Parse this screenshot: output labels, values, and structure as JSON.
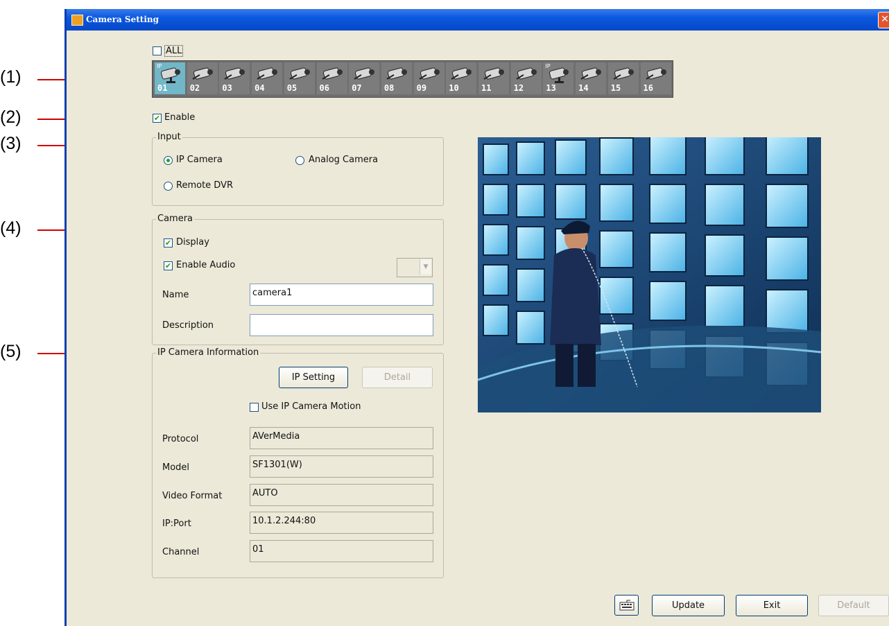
{
  "callouts": [
    "(1)",
    "(2)",
    "(3)",
    "(4)",
    "(5)"
  ],
  "window": {
    "title": "Camera Setting",
    "close_glyph": "✕"
  },
  "all_checkbox": {
    "label": "ALL",
    "checked": false
  },
  "camera_strip": {
    "selected": "01",
    "cameras": [
      {
        "num": "01",
        "ip": true
      },
      {
        "num": "02",
        "ip": false
      },
      {
        "num": "03",
        "ip": false
      },
      {
        "num": "04",
        "ip": false
      },
      {
        "num": "05",
        "ip": false
      },
      {
        "num": "06",
        "ip": false
      },
      {
        "num": "07",
        "ip": false
      },
      {
        "num": "08",
        "ip": false
      },
      {
        "num": "09",
        "ip": false
      },
      {
        "num": "10",
        "ip": false
      },
      {
        "num": "11",
        "ip": false
      },
      {
        "num": "12",
        "ip": false
      },
      {
        "num": "13",
        "ip": true
      },
      {
        "num": "14",
        "ip": false
      },
      {
        "num": "15",
        "ip": false
      },
      {
        "num": "16",
        "ip": false
      }
    ],
    "ip_tag": "IP"
  },
  "enable": {
    "label": "Enable",
    "checked": true
  },
  "input_group": {
    "title": "Input",
    "options": [
      {
        "label": "IP Camera",
        "selected": true
      },
      {
        "label": "Analog Camera",
        "selected": false
      },
      {
        "label": "Remote DVR",
        "selected": false
      }
    ]
  },
  "camera_group": {
    "title": "Camera",
    "display_label": "Display",
    "display_checked": true,
    "audio_label": "Enable Audio",
    "audio_checked": true,
    "audio_select_value": "",
    "name_label": "Name",
    "name_value": "camera1",
    "description_label": "Description",
    "description_value": ""
  },
  "ip_group": {
    "title": "IP Camera Information",
    "ip_setting_label": "IP Setting",
    "detail_label": "Detail",
    "motion_label": "Use IP Camera Motion",
    "motion_checked": false,
    "fields": [
      {
        "label": "Protocol",
        "value": "AVerMedia"
      },
      {
        "label": "Model",
        "value": "SF1301(W)"
      },
      {
        "label": "Video Format",
        "value": "AUTO"
      },
      {
        "label": "IP:Port",
        "value": "10.1.2.244:80"
      },
      {
        "label": "Channel",
        "value": "01"
      }
    ]
  },
  "bottom_buttons": {
    "keyboard_icon": "keyboard-icon",
    "update": "Update",
    "exit": "Exit",
    "default": "Default"
  },
  "colors": {
    "dialog_bg": "#ece9d8",
    "titlebar": "#0a58e0",
    "callout_line": "#d00000",
    "selected_cam": "#71b7c8"
  }
}
